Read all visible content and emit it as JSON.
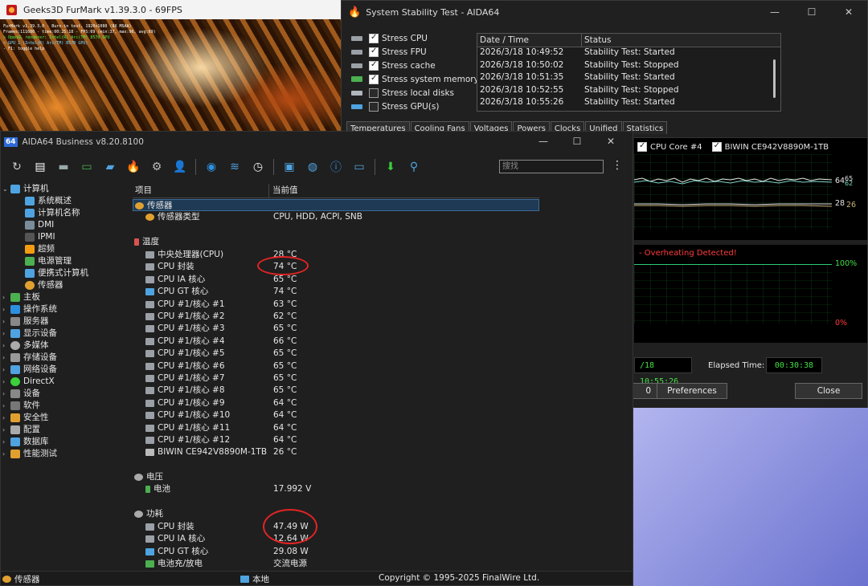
{
  "furmark": {
    "title": "Geeks3D FurMark v1.39.3.0 - 69FPS",
    "osd": [
      "FurMark v1.39.3.0 - Burn-in test, 1920x1080 (8X MSAA)",
      "Frames:111680 - time:00:25:18 - FPS:69 (min:37, max:96, avg:69)",
      "> OpenGL renderer: Intel(R) Arc(TM) 8570 GPU",
      "> GPU 1 (Intel(R) Arc(TM) B570 GPU)",
      "- F1: toggle help"
    ]
  },
  "stability": {
    "title": "System Stability Test - AIDA64",
    "stress": [
      {
        "label": "Stress CPU",
        "checked": true
      },
      {
        "label": "Stress FPU",
        "checked": true
      },
      {
        "label": "Stress cache",
        "checked": true
      },
      {
        "label": "Stress system memory",
        "checked": true
      },
      {
        "label": "Stress local disks",
        "checked": false
      },
      {
        "label": "Stress GPU(s)",
        "checked": false
      }
    ],
    "log_headers": {
      "date": "Date / Time",
      "status": "Status"
    },
    "log": [
      {
        "date": "2026/3/18 10:49:52",
        "status": "Stability Test: Started"
      },
      {
        "date": "2026/3/18 10:50:02",
        "status": "Stability Test: Stopped"
      },
      {
        "date": "2026/3/18 10:51:35",
        "status": "Stability Test: Started"
      },
      {
        "date": "2026/3/18 10:52:55",
        "status": "Stability Test: Stopped"
      },
      {
        "date": "2026/3/18 10:55:26",
        "status": "Stability Test: Started"
      }
    ],
    "tabs": [
      "Temperatures",
      "Cooling Fans",
      "Voltages",
      "Powers",
      "Clocks",
      "Unified",
      "Statistics"
    ],
    "graph1": {
      "legend": [
        "CPU Core #4",
        "BIWIN CE942V8890M-1TB"
      ],
      "label_top_a": "64",
      "label_top_b": "65",
      "label_top_c": "62",
      "label_bottom_a": "28",
      "label_bottom_b": "26"
    },
    "graph2": {
      "warning": "- Overheating Detected!",
      "max": "100%",
      "min": "0%"
    },
    "start_time": "/18 10:55:26",
    "elapsed_label": "Elapsed Time:",
    "elapsed_value": "00:30:38",
    "btn_partial": "0",
    "preferences": "Preferences",
    "close": "Close"
  },
  "aida": {
    "title": "AIDA64 Business v8.20.8100",
    "badge": "64",
    "search_placeholder": "搜找",
    "tree": {
      "computer": "计算机",
      "summary": "系统概述",
      "name": "计算机名称",
      "dmi": "DMI",
      "ipmi": "IPMI",
      "oc": "超频",
      "power": "电源管理",
      "portable": "便携式计算机",
      "sensor": "传感器",
      "mainboard": "主板",
      "os": "操作系统",
      "server": "服务器",
      "display": "显示设备",
      "multimedia": "多媒体",
      "storage": "存储设备",
      "network": "网络设备",
      "directx": "DirectX",
      "devices": "设备",
      "software": "软件",
      "security": "安全性",
      "config": "配置",
      "database": "数据库",
      "benchmark": "性能测试"
    },
    "list_headers": {
      "item": "项目",
      "value": "当前值"
    },
    "sensor_section": "传感器",
    "sensor_type": {
      "name": "传感器类型",
      "value": "CPU, HDD, ACPI, SNB"
    },
    "temp_section": "温度",
    "temps": [
      {
        "name": "中央处理器(CPU)",
        "value": "28 °C"
      },
      {
        "name": "CPU 封装",
        "value": "74 °C"
      },
      {
        "name": "CPU IA 核心",
        "value": "65 °C"
      },
      {
        "name": "CPU GT 核心",
        "value": "74 °C"
      },
      {
        "name": "CPU #1/核心 #1",
        "value": "63 °C"
      },
      {
        "name": "CPU #1/核心 #2",
        "value": "62 °C"
      },
      {
        "name": "CPU #1/核心 #3",
        "value": "65 °C"
      },
      {
        "name": "CPU #1/核心 #4",
        "value": "66 °C"
      },
      {
        "name": "CPU #1/核心 #5",
        "value": "65 °C"
      },
      {
        "name": "CPU #1/核心 #6",
        "value": "65 °C"
      },
      {
        "name": "CPU #1/核心 #7",
        "value": "65 °C"
      },
      {
        "name": "CPU #1/核心 #8",
        "value": "65 °C"
      },
      {
        "name": "CPU #1/核心 #9",
        "value": "64 °C"
      },
      {
        "name": "CPU #1/核心 #10",
        "value": "64 °C"
      },
      {
        "name": "CPU #1/核心 #11",
        "value": "64 °C"
      },
      {
        "name": "CPU #1/核心 #12",
        "value": "64 °C"
      },
      {
        "name": "BIWIN CE942V8890M-1TB",
        "value": "26 °C"
      }
    ],
    "volt_section": "电压",
    "volts": [
      {
        "name": "电池",
        "value": "17.992 V"
      }
    ],
    "power_section": "功耗",
    "powers": [
      {
        "name": "CPU 封装",
        "value": "47.49 W"
      },
      {
        "name": "CPU IA 核心",
        "value": "12.64 W"
      },
      {
        "name": "CPU GT 核心",
        "value": "29.08 W"
      },
      {
        "name": "电池充/放电",
        "value": "交流电源"
      }
    ],
    "status": {
      "left": "传感器",
      "mid": "本地",
      "right": "Copyright © 1995-2025 FinalWire Ltd."
    }
  },
  "colors": {
    "accent": "#2d6bd6",
    "annotation": "#e32424",
    "elapsed": "#45e045",
    "warning": "#ff3b3b"
  }
}
